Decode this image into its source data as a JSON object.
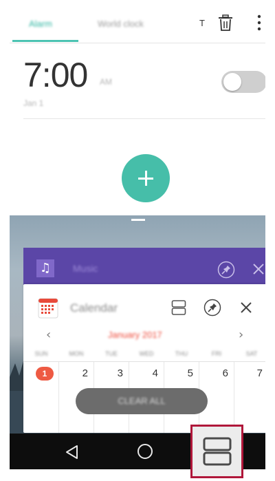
{
  "alarm_app": {
    "tabs": [
      {
        "label": "Alarm",
        "active": true
      },
      {
        "label": "World clock",
        "active": false
      }
    ],
    "toolbar": {
      "t_label": "T",
      "trash_icon": "trash-icon",
      "more_icon": "more-vert-icon"
    },
    "alarm": {
      "time": "7:00",
      "ampm": "AM",
      "date": "Jan 1",
      "enabled": false
    },
    "add_icon": "plus-icon",
    "accent_color": "#46bea9"
  },
  "recents": {
    "music_card": {
      "app_name": "Music",
      "color": "#5b46a7"
    },
    "calendar_card": {
      "app_name": "Calendar",
      "month": "January 2017",
      "prev_icon": "chevron-left-icon",
      "next_icon": "chevron-right-icon",
      "weekdays": [
        "SUN",
        "MON",
        "TUE",
        "WED",
        "THU",
        "FRI",
        "SAT"
      ],
      "days": [
        "1",
        "2",
        "3",
        "4",
        "5",
        "6",
        "7"
      ],
      "today": "1"
    },
    "clear_all_label": "CLEAR ALL"
  },
  "navbar": {
    "back_icon": "back-icon",
    "home_icon": "home-icon",
    "split_icon": "split-screen-icon",
    "highlight_color": "#b0173a"
  }
}
